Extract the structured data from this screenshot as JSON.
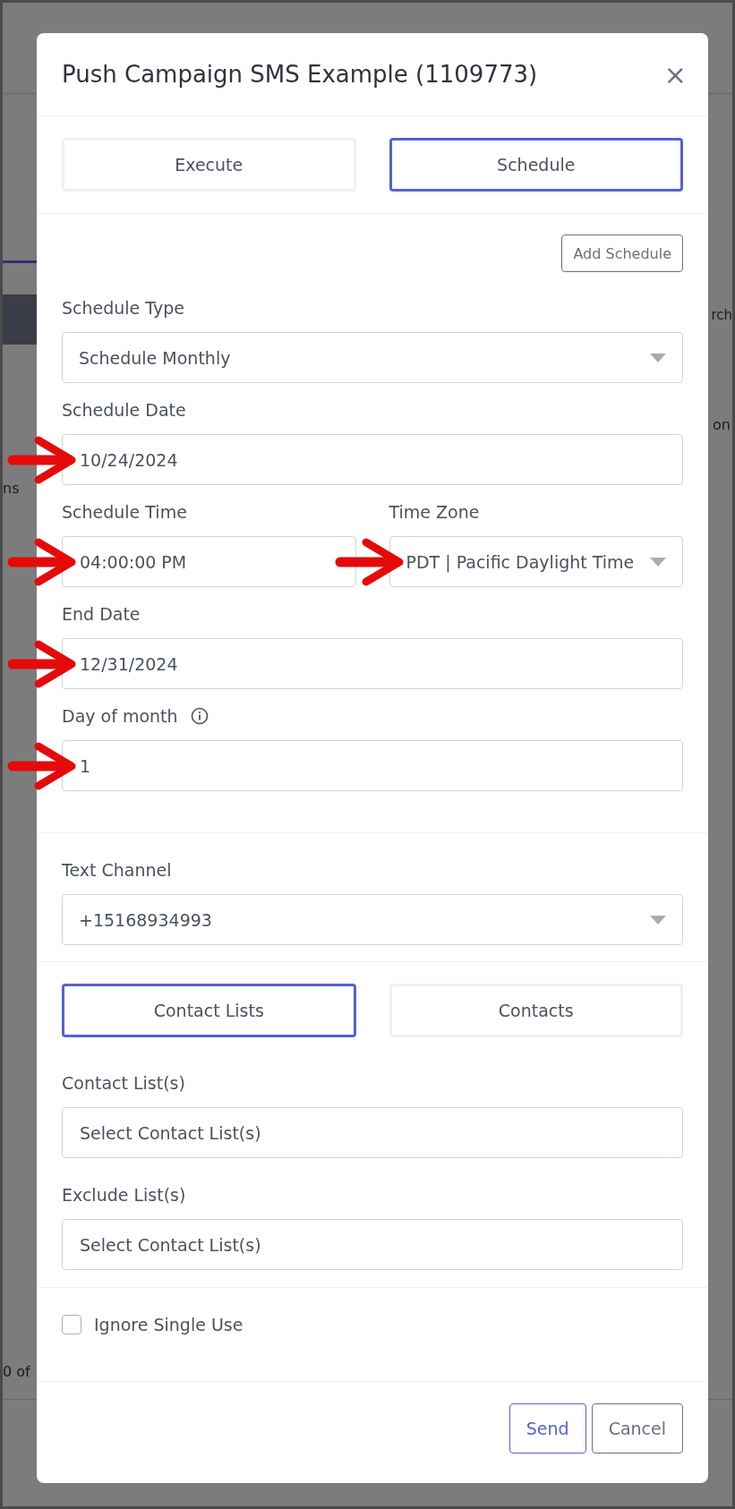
{
  "background_fragments": [
    {
      "text": "rch"
    },
    {
      "text": "on"
    },
    {
      "text": "ns"
    },
    {
      "text": "0 of"
    }
  ],
  "modal": {
    "title": "Push Campaign SMS Example (1109773)",
    "close": "×"
  },
  "mode_tabs": [
    {
      "label": "Execute",
      "selected": false
    },
    {
      "label": "Schedule",
      "selected": true
    }
  ],
  "add_schedule_button": "Add Schedule",
  "schedule_rows": [
    [
      {
        "label": "Schedule Type",
        "kind": "select",
        "value": "Schedule Monthly",
        "arrow": false,
        "info": false
      }
    ],
    [
      {
        "label": "Schedule Date",
        "kind": "input",
        "value": "10/24/2024",
        "arrow": true,
        "info": false
      }
    ],
    [
      {
        "label": "Schedule Time",
        "kind": "input",
        "value": "04:00:00 PM",
        "arrow": true,
        "info": false
      },
      {
        "label": "Time Zone",
        "kind": "select",
        "value": "PDT | Pacific Daylight Time",
        "arrow": true,
        "info": false
      }
    ],
    [
      {
        "label": "End Date",
        "kind": "input",
        "value": "12/31/2024",
        "arrow": true,
        "info": false
      }
    ],
    [
      {
        "label": "Day of month",
        "kind": "input",
        "value": "1",
        "arrow": true,
        "info": true
      }
    ]
  ],
  "text_channel": {
    "label": "Text Channel",
    "kind": "select",
    "value": "+15168934993"
  },
  "recipient_tabs": [
    {
      "label": "Contact Lists",
      "selected": true
    },
    {
      "label": "Contacts",
      "selected": false
    }
  ],
  "recipient_fields": [
    {
      "label": "Contact List(s)",
      "placeholder": "Select Contact List(s)"
    },
    {
      "label": "Exclude List(s)",
      "placeholder": "Select Contact List(s)"
    }
  ],
  "ignore_single_use": {
    "label": "Ignore Single Use",
    "checked": false
  },
  "footer_buttons": [
    {
      "label": "Send",
      "kind": "primary"
    },
    {
      "label": "Cancel",
      "kind": "secondary"
    }
  ]
}
